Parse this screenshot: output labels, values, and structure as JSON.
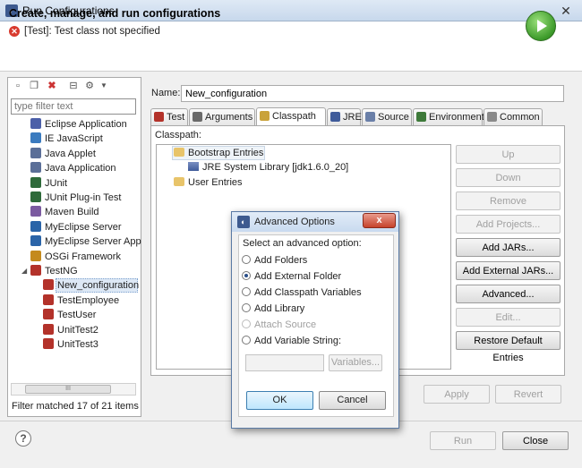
{
  "window": {
    "title": "Run Configurations",
    "close_glyph": "✕"
  },
  "header": {
    "title": "Create, manage, and run configurations",
    "error_message": "[Test]: Test class not specified"
  },
  "left": {
    "filter_placeholder": "type filter text",
    "status": "Filter matched 17 of 21 items",
    "scrollbar_grip": "III",
    "tree": [
      {
        "label": "Eclipse Application",
        "color": "#4b5fa8"
      },
      {
        "label": "IE JavaScript",
        "color": "#3b7bbf"
      },
      {
        "label": "Java Applet",
        "color": "#5b6f98"
      },
      {
        "label": "Java Application",
        "color": "#5b6f98"
      },
      {
        "label": "JUnit",
        "color": "#2e6a3a"
      },
      {
        "label": "JUnit Plug-in Test",
        "color": "#2e6a3a"
      },
      {
        "label": "Maven Build",
        "color": "#7b5aa0"
      },
      {
        "label": "MyEclipse Server",
        "color": "#2a64a8"
      },
      {
        "label": "MyEclipse Server App",
        "color": "#2a64a8"
      },
      {
        "label": "OSGi Framework",
        "color": "#c48a1e"
      },
      {
        "label": "TestNG",
        "color": "#b3322a"
      },
      {
        "label": "New_configuration",
        "color": "#b3322a"
      },
      {
        "label": "TestEmployee",
        "color": "#b3322a"
      },
      {
        "label": "TestUser",
        "color": "#b3322a"
      },
      {
        "label": "UnitTest2",
        "color": "#b3322a"
      },
      {
        "label": "UnitTest3",
        "color": "#b3322a"
      }
    ]
  },
  "main": {
    "name_label": "Name:",
    "name_value": "New_configuration",
    "tabs": [
      "Test",
      "Arguments",
      "Classpath",
      "JRE",
      "Source",
      "Environment",
      "Common"
    ],
    "classpath_label": "Classpath:",
    "entries": {
      "bootstrap": "Bootstrap Entries",
      "jre": "JRE System Library [jdk1.6.0_20]",
      "user": "User Entries"
    },
    "buttons": {
      "up": "Up",
      "down": "Down",
      "remove": "Remove",
      "add_projects": "Add Projects...",
      "add_jars": "Add JARs...",
      "add_external_jars": "Add External JARs...",
      "advanced": "Advanced...",
      "edit": "Edit...",
      "restore": "Restore Default Entries"
    },
    "apply": "Apply",
    "revert": "Revert"
  },
  "footer": {
    "run": "Run",
    "close": "Close",
    "help_glyph": "?"
  },
  "dialog": {
    "title": "Advanced Options",
    "close_glyph": "x",
    "prompt": "Select an advanced option:",
    "options": [
      {
        "label": "Add Folders"
      },
      {
        "label": "Add External Folder"
      },
      {
        "label": "Add Classpath Variables"
      },
      {
        "label": "Add Library"
      },
      {
        "label": "Attach Source"
      },
      {
        "label": "Add Variable String:"
      }
    ],
    "selected_option": "Add External Folder",
    "variables_button": "Variables...",
    "ok": "OK",
    "cancel": "Cancel"
  }
}
